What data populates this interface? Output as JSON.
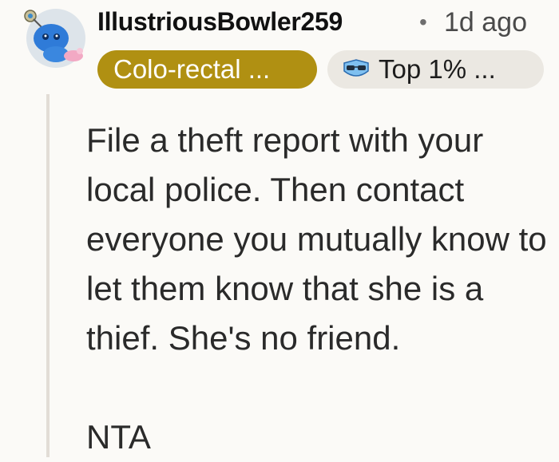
{
  "comment": {
    "author": "IllustriousBowler259",
    "separator": "•",
    "timestamp": "1d ago",
    "user_flair": "Colo-rectal ...",
    "achievement_badge": "Top 1% ...",
    "body_paragraphs": [
      "File a theft report with your local police. Then contact everyone you mutually know to let them know that she is a thief. She's no friend.",
      "NTA"
    ]
  },
  "colors": {
    "flair_background": "#b09012",
    "badge_background": "#ebe8e2",
    "thread_line": "#e2ddd6"
  },
  "icons": {
    "avatar": "snoo-avatar-icon",
    "achievement": "sunglasses-badge-icon"
  }
}
